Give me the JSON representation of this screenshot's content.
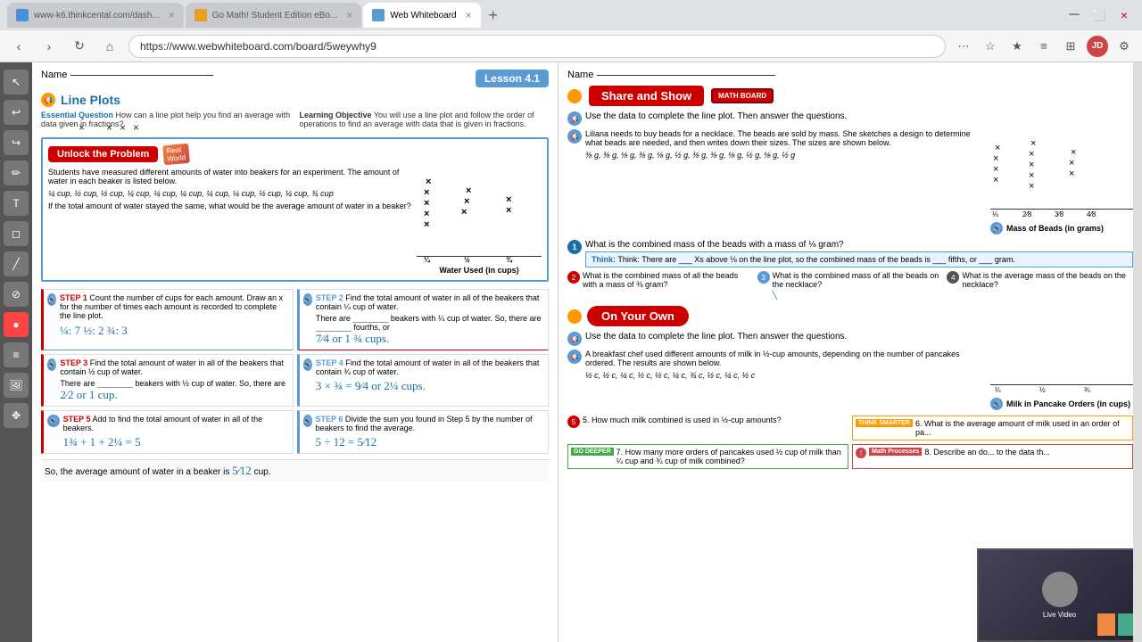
{
  "browser": {
    "tabs": [
      {
        "id": "k6",
        "label": "www-k6.thinkcental.com/dash...",
        "favicon": "k6",
        "active": false
      },
      {
        "id": "gomath",
        "label": "Go Math! Student Edition eBo...",
        "favicon": "gomath",
        "active": false
      },
      {
        "id": "wb",
        "label": "Web Whiteboard",
        "favicon": "wb",
        "active": true
      }
    ],
    "url": "https://www.webwhiteboard.com/board/5weywhy9"
  },
  "left_page": {
    "lesson_badge": "Lesson 4.1",
    "name_label": "Name",
    "section_title": "Line Plots",
    "essential_question_label": "Essential Question",
    "essential_question": "How can a line plot help you find an average with data given in fractions?",
    "learning_objective_label": "Learning Objective",
    "learning_objective": "You will use a line plot and follow the order of operations to find an average with data that is given in fractions.",
    "unlock_label": "Unlock the Problem",
    "problem_text": "Students have measured different amounts of water into beakers for an experiment. The amount of water in each beaker is listed below.",
    "water_values": "¼ cup, ½ cup, ½ cup, ¼ cup, ¼ cup, ¼ cup, ¼ cup, ¼ cup, ½ cup, ¼ cup, ¾ cup",
    "question": "If the total amount of water stayed the same, what would be the average amount of water in a beaker?",
    "chart_title": "Water Used (in cups)",
    "steps": [
      {
        "num": "STEP 1",
        "text": "Count the number of cups for each amount. Draw an x for the number of times each amount is recorded to complete the line plot."
      },
      {
        "num": "STEP 2",
        "text": "Find the total amount of water in all of the beakers that contain ¼ cup of water.",
        "detail": "There are ___ beakers with ¼ cup of water. So, there are ___ fourths, or __ or 1 __ cups."
      },
      {
        "num": "STEP 3",
        "text": "Find the total amount of water in all of the beakers that contain ½ cup of water.",
        "detail": "There are ___ beakers with ½ cup of water. So, there are ___ halves, or __ or 1 cup."
      },
      {
        "num": "STEP 4",
        "text": "Find the total amount of water in all of the beakers that contain ¾ cup of water.",
        "detail": "3 × ¾ = __ or __ cups."
      },
      {
        "num": "STEP 5",
        "text": "Add to find the total amount of water in all of the beakers.",
        "detail": "1¾ + 1 + 2¼ = 5"
      },
      {
        "num": "STEP 6",
        "text": "Divide the sum you found in Step 5 by the number of beakers to find the average.",
        "detail": "5 ÷ 12 = 5/12"
      }
    ],
    "conclusion": "So, the average amount of water in a beaker is ___ cup."
  },
  "right_page": {
    "name_label": "Name",
    "share_show_label": "Share and Show",
    "math_board_label": "MATH BOARD",
    "instruction": "Use the data to complete the line plot. Then answer the questions.",
    "beads_text": "Liliana needs to buy beads for a necklace. The beads are sold by mass. She sketches a design to determine what beads are needed, and then writes down their sizes. The sizes are shown below.",
    "bead_sizes": "⅜ g, ⅜ g, ⅛ g, ⅜ g, ⅛ g, ½ g, ⅜ g, ⅜ g, ⅛ g, ½ g, ⅛ g, ½ g",
    "mass_label": "Mass of Beads (in grams)",
    "questions": [
      {
        "num": "1.",
        "text": "What is the combined mass of the beads with a mass of ⅛ gram?",
        "think": "Think: There are ___ Xs above ⅛ on the line plot, so the combined mass of the beads is ___ fifths, or ___ gram."
      },
      {
        "num": "2.",
        "text": "What is the combined mass of all the beads with a mass of ⅜ gram?"
      },
      {
        "num": "3.",
        "text": "What is the combined mass of all the beads on the necklace?"
      },
      {
        "num": "4.",
        "text": "What is the average mass of the beads on the necklace?"
      }
    ],
    "on_your_own_label": "On Your Own",
    "oya_instruction": "Use the data to complete the line plot. Then answer the questions.",
    "pancake_text": "A breakfast chef used different amounts of milk in ½-cup amounts, depending on the number of pancakes ordered. The results are shown below.",
    "milk_values": "½ c, ½ c, ¼ c, ½ c, ½ c, ¼ c, ¾ c, ½ c, ¼ c, ½ c",
    "milk_label": "Milk in Pancake Orders (in cups)",
    "q5": "5. How much milk combined is used in ½-cup amounts?",
    "q6_label": "THINK SMARTER",
    "q6": "6. What is the average amount of milk used in an order of pa...",
    "q7_label": "GO DEEPER",
    "q7": "7. How many more orders of pancakes used ½ cup of milk than ¼ cup and ¾ cup of milk combined?",
    "q8_label": "Math Processes",
    "q8": "8. Describe an do... to the data th..."
  }
}
